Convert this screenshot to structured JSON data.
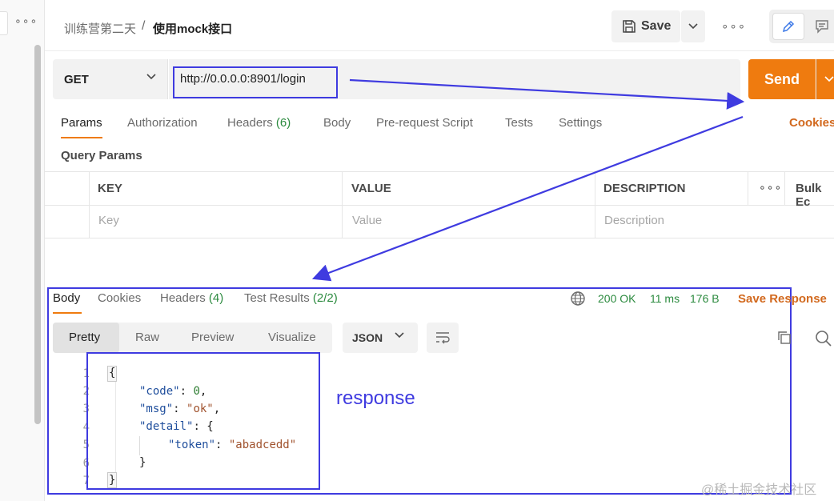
{
  "sidebar": {
    "more_label": "∘∘∘"
  },
  "header": {
    "breadcrumb_parent": "训练营第二天",
    "breadcrumb_separator": "/",
    "breadcrumb_current": "使用mock接口",
    "save_label": "Save",
    "more_label": "∘∘∘"
  },
  "request": {
    "method": "GET",
    "url": "http://0.0.0.0:8901/login",
    "send_label": "Send",
    "tabs": {
      "params": "Params",
      "authorization": "Authorization",
      "headers": "Headers",
      "headers_count": "(6)",
      "body": "Body",
      "prerequest": "Pre-request Script",
      "tests": "Tests",
      "settings": "Settings"
    },
    "cookies_label": "Cookies",
    "query_params_title": "Query Params",
    "table": {
      "col_key": "KEY",
      "col_value": "VALUE",
      "col_description": "DESCRIPTION",
      "more_label": "∘∘∘",
      "bulk_edit": "Bulk Ec",
      "ph_key": "Key",
      "ph_value": "Value",
      "ph_description": "Description"
    }
  },
  "response": {
    "tabs": {
      "body": "Body",
      "cookies": "Cookies",
      "headers": "Headers",
      "headers_count": "(4)",
      "test_results": "Test Results",
      "test_results_count": "(2/2)"
    },
    "status": "200 OK",
    "time": "11 ms",
    "size": "176 B",
    "save_response": "Save Response",
    "formats": {
      "pretty": "Pretty",
      "raw": "Raw",
      "preview": "Preview",
      "visualize": "Visualize"
    },
    "language": "JSON",
    "line_numbers": [
      "1",
      "2",
      "3",
      "4",
      "5",
      "6",
      "7"
    ],
    "code": {
      "l1_open": "{",
      "code_key": "\"code\"",
      "code_val": "0",
      "msg_key": "\"msg\"",
      "msg_val": "\"ok\"",
      "detail_key": "\"detail\"",
      "detail_open": "{",
      "token_key": "\"token\"",
      "token_val": "\"abadcedd\"",
      "inner_close": "}",
      "l7_close": "}"
    }
  },
  "annotations": {
    "response_label": "response",
    "arrow_color": "#3f3be0"
  },
  "watermark": "@稀土掘金技术社区",
  "colors": {
    "send": "#ef7b0f",
    "accent": "#d2691e",
    "success": "#2b8a3e",
    "annotation": "#3f3be0"
  }
}
